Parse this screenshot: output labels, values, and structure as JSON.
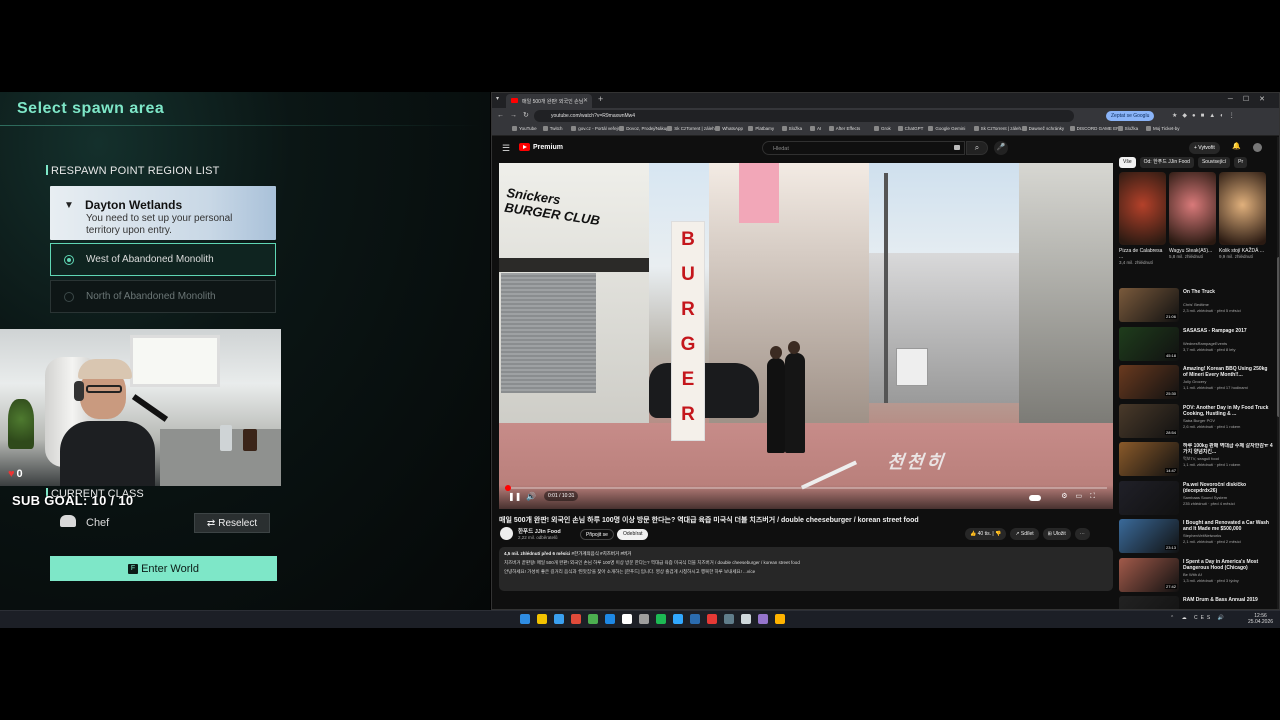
{
  "game": {
    "title": "Select spawn area",
    "region_header": "RESPAWN POINT REGION LIST",
    "region": {
      "name": "Dayton Wetlands",
      "description": "You need to set up your personal territory upon entry."
    },
    "spawn_options": [
      {
        "label": "West of Abandoned Monolith",
        "selected": true
      },
      {
        "label": "North of Abandoned Monolith",
        "selected": false
      }
    ],
    "class_header": "CURRENT CLASS",
    "class_name": "Chef",
    "reselect_label": "Reselect",
    "enter_label": "Enter World",
    "enter_key": "F"
  },
  "overlay": {
    "hearts": "0",
    "sub_goal": "SUB GOAL: 10 / 10"
  },
  "browser": {
    "tab_title": "매일 500개 완판! 외국인 손님",
    "url": "youtube.com/watch?v=R9maxwnMw4",
    "google_btn": "Zeptat se Googlu",
    "bookmarks": [
      "YouTube",
      "Twitch",
      "gov.cz - Portál veřejn...",
      "Dovoz, Prodej/Nákup...",
      "Sk CzTorrent | záleh...",
      "WhatsApp",
      "Platbamy",
      "Složka",
      "AI",
      "After Effects",
      "Grok",
      "ChatGPT",
      "Google Gemini",
      "Sk CzTorrent | záleh...",
      "Dawnež schránky",
      "DISCORD GAME ER...",
      "Složka",
      "Moj Ticket-by"
    ]
  },
  "youtube": {
    "logo": "Premium",
    "search_placeholder": "Hledat",
    "create_label": "+ Vytvořit",
    "video": {
      "time": "0:01 / 10:31",
      "progress": 0.005,
      "title": "매일 500개 완판! 외국인 손님 하루 100명 이상 방문 한다는? 역대급 육즙 미국식 더블 치즈버거 / double cheeseburger / korean street food",
      "channel": "한푸드 JJin Food",
      "subs": "2,22 mil. odběratelů",
      "join": "Připojit se",
      "subscribe": "Odebírat",
      "likes": "40 tis.",
      "share": "Sdílet",
      "save": "Uložit",
      "desc_meta": "4,5 mil. zhlédnutí  před 6 měsíci",
      "desc_tags": "#한가게의음식 #치즈버거 #버거",
      "desc_line1": "치즈버거 끝판왕! 매일 500개 완판! 외국인 손님 하루 100명 이상 방문 한다는? 역대급 육즙 미국식 더블 치즈버거 / double cheeseburger / korean street food",
      "desc_line2": "안녕하세요! 가성비 좋은 길거리 음식과 '찐맛집'을 찾아 소개하는 [한푸드] 입니다. 영상 즐겁게 시청하시고 행복한 하루 보내세요!  ...více"
    },
    "chips": [
      "Vše",
      "Od: 한푸드 JJin Food",
      "Související",
      "Pr"
    ],
    "shorts": [
      {
        "title": "Pizza de Calabresa ...",
        "views": "3,4 mil. zhlédnutí",
        "color": "#b4412a"
      },
      {
        "title": "Wagyu Steak(A5)...",
        "views": "5,8 mil. zhlédnutí",
        "color": "#d97a7a"
      },
      {
        "title": "Kolik stojí KAŽDÁ ...",
        "views": "9,9 mil. zhlédnutí",
        "color": "#e0b07c"
      }
    ],
    "recs": [
      {
        "title": "On The Truck",
        "channel": "Chris' Bedtime",
        "meta": "2,3 mil. zhlédnutí · před 5 měsíci",
        "dur": "21:06",
        "color": "#7a5a3c"
      },
      {
        "title": "SASASAS - Rampage 2017",
        "channel": "WednesRampageEvents",
        "meta": "3,7 mil. zhlédnutí · před 8 lety",
        "dur": "45:18",
        "color": "#1f3d1c"
      },
      {
        "title": "Amazing! Korean BBQ Using 250kg of Mineri Every Month!!...",
        "channel": "Jolly Grocery",
        "meta": "1,1 mil. zhlédnutí · před 17 hodinami",
        "dur": "25:30",
        "color": "#6a3a1f"
      },
      {
        "title": "POV: Another Day in My Food Truck Cooking, Hustling & ...",
        "channel": "Saba Burger POV",
        "meta": "2,6 mil. zhlédnutí · před 1 rokem",
        "dur": "28:54",
        "color": "#4a3a2a"
      },
      {
        "title": "하루 100kg 판매 역대급 수제 갈자한감ㅠ 4가지 양념치킨...",
        "channel": "먹보TV, seagull food",
        "meta": "1,1 mil. zhlédnutí · před 1 rokem",
        "dur": "14:47",
        "color": "#8a5a2a"
      },
      {
        "title": "Pa.wei Novoroční diskíčko (decepdrdx26)",
        "channel": "Sambaas Sound System",
        "meta": "235 zhlédnutí · před 4 měsíci",
        "dur": "",
        "color": "#202028"
      },
      {
        "title": "I Bought and Renovated a Car Wash and It Made me $500,000",
        "channel": "StephenVeitNetworks",
        "meta": "2,1 mil. zhlédnutí · před 2 měsíci",
        "dur": "23:13",
        "color": "#3a6a9a"
      },
      {
        "title": "I Spent a Day in America's Most Dangerous Hood (Chicago)",
        "channel": "Be With Af",
        "meta": "1,3 mil. zhlédnutí · před 3 týdny",
        "dur": "27:42",
        "color": "#a25a4a"
      },
      {
        "title": "RAM Drum & Bass Annual 2019",
        "channel": "",
        "meta": "",
        "dur": "",
        "color": "#222"
      }
    ]
  },
  "taskbar": {
    "clock_time": "12:56",
    "clock_date": "25.04.2026",
    "tray_lang": "CES"
  }
}
